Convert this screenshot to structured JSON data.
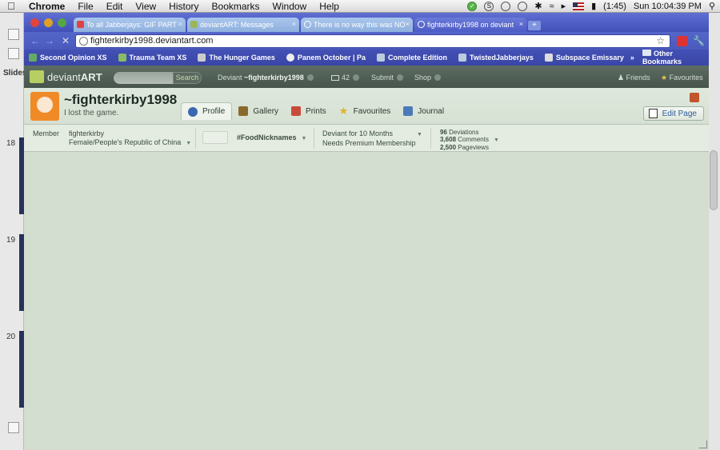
{
  "menubar": {
    "app": "Chrome",
    "items": [
      "File",
      "Edit",
      "View",
      "History",
      "Bookmarks",
      "Window",
      "Help"
    ],
    "battery": "(1:45)",
    "clock": "Sun 10:04:39 PM"
  },
  "bgapp": {
    "label": "Slides",
    "numbers": [
      "18",
      "19",
      "20"
    ]
  },
  "tabs": [
    {
      "title": "To all Jabberjays: GIF PART"
    },
    {
      "title": "deviantART: Messages"
    },
    {
      "title": "There is no way this was NO"
    },
    {
      "title": "fighterkirby1998 on deviant"
    }
  ],
  "address": "fighterkirby1998.deviantart.com",
  "bookmarks": [
    {
      "label": "Second Opinion XS"
    },
    {
      "label": "Trauma Team XS"
    },
    {
      "label": "The Hunger Games"
    },
    {
      "label": "Panem October | Pa"
    },
    {
      "label": "Complete Edition"
    },
    {
      "label": "TwistedJabberjays"
    },
    {
      "label": "Subspace Emissary"
    }
  ],
  "other_bookmarks": "Other Bookmarks",
  "da": {
    "logo_a": "deviant",
    "logo_b": "ART",
    "search_button": "Search",
    "deviant_prefix": "Deviant",
    "deviant_name": "~fighterkirby1998",
    "messages": "42",
    "submit": "Submit",
    "shop": "Shop",
    "friends": "Friends",
    "favourites": "Favourites"
  },
  "profile": {
    "username": "~fighterkirby1998",
    "tagline": "I lost the game.",
    "tabs": [
      "Profile",
      "Gallery",
      "Prints",
      "Favourites",
      "Journal"
    ],
    "edit_page": "Edit Page"
  },
  "stats": {
    "member_label": "Member",
    "member_name": "fighterkirby",
    "member_location": "Female/People's Republic of China",
    "hashtag": "#FoodNicknames",
    "deviant_for": "Deviant for 10 Months",
    "premium": "Needs Premium Membership",
    "deviations_num": "96",
    "deviations_label": "Deviations",
    "comments_num": "3,608",
    "comments_label": "Comments",
    "pageviews_num": "2,500",
    "pageviews_label": "Pageviews"
  }
}
